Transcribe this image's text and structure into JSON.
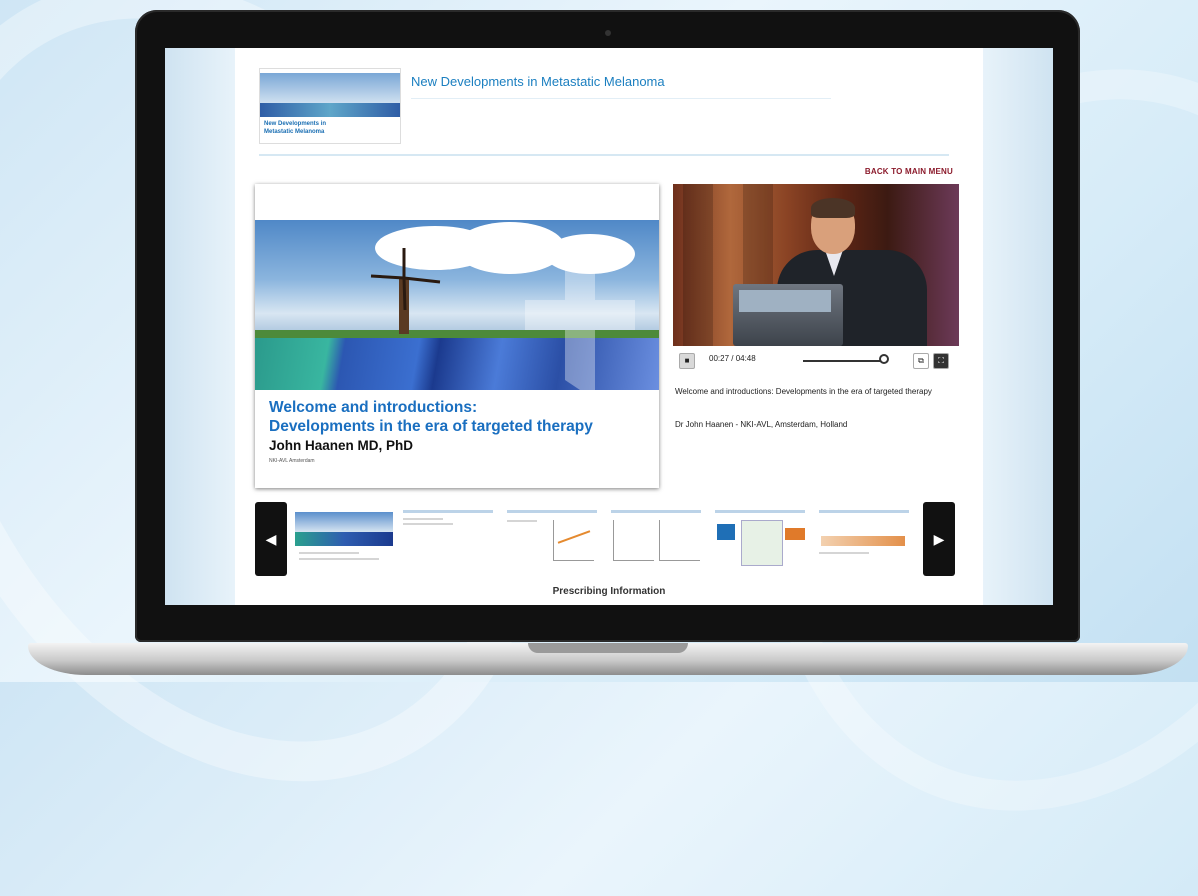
{
  "page": {
    "title": "New Developments in Metastatic Melanoma",
    "back_link": "BACK TO MAIN MENU",
    "header_thumb_line1": "New Developments in",
    "header_thumb_line2": "Metastatic Melanoma",
    "footer_link": "Prescribing Information"
  },
  "slide": {
    "heading_line1": "Welcome and introductions:",
    "heading_line2": "Developments in the era of targeted therapy",
    "speaker": "John Haanen MD, PhD",
    "affiliation": "NKI-AVL Amsterdam"
  },
  "video": {
    "time": "00:27 / 04:48",
    "title": "Welcome and introductions: Developments in the era of targeted therapy",
    "speaker_line": "Dr John Haanen - NKI-AVL, Amsterdam, Holland",
    "progress_fraction": 1.0
  },
  "icons": {
    "play": "play-icon",
    "popout": "popout-icon",
    "fullscreen": "fullscreen-icon",
    "prev": "chevron-left-icon",
    "next": "chevron-right-icon"
  },
  "colors": {
    "accent": "#1b7fc0",
    "back_link": "#8b1a2b"
  }
}
